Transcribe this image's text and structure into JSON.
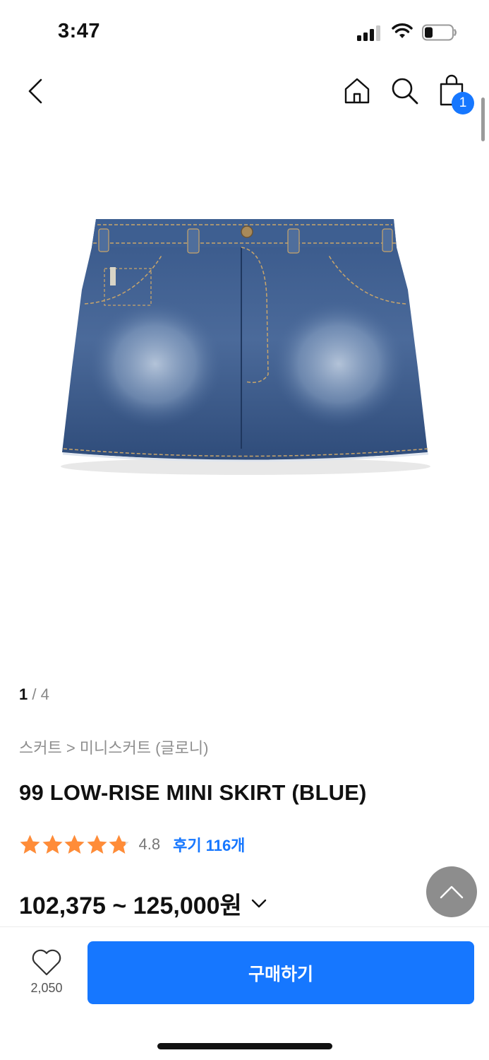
{
  "status_bar": {
    "time": "3:47"
  },
  "nav": {
    "cart_count": "1",
    "icons": [
      "back-icon",
      "home-icon",
      "search-icon",
      "shopping-bag-icon"
    ]
  },
  "gallery": {
    "current": "1",
    "separator": " / ",
    "total": "4"
  },
  "product": {
    "breadcrumb": "스커트 > 미니스커트 (글로니)",
    "title": "99 LOW-RISE MINI SKIRT (BLUE)",
    "rating": "4.8",
    "rating_stars": 4.8,
    "reviews_label": "후기 116개",
    "price": "102,375 ~ 125,000원"
  },
  "bottom_bar": {
    "like_count": "2,050",
    "buy_label": "구매하기"
  },
  "colors": {
    "accent": "#1677ff",
    "star": "#ff8c38",
    "scroll_top": "#8d8d8d"
  }
}
